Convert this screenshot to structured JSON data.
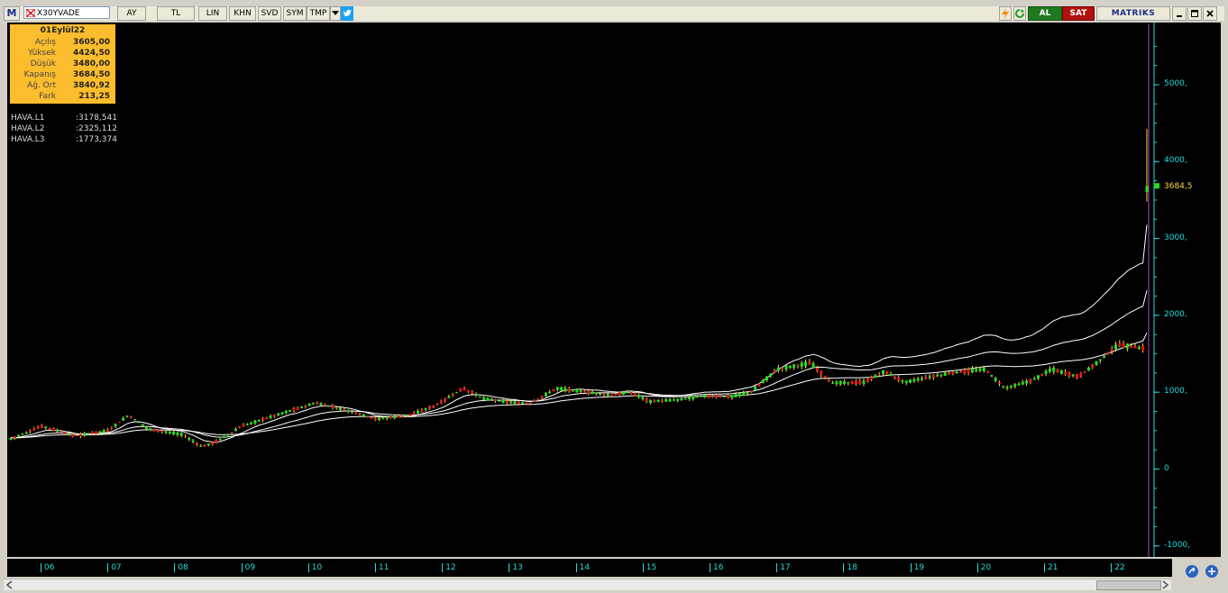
{
  "toolbar": {
    "app_mark": "M",
    "symbol": "X30YVADE",
    "buttons": [
      "AY",
      "TL",
      "LIN",
      "KHN",
      "SVD",
      "SYM",
      "TMP"
    ],
    "buy_label": "AL",
    "sell_label": "SAT",
    "brand": "MATRIKS",
    "colors": {
      "buy": "#1f7a1f",
      "sell": "#b01212",
      "brand": "#1c2e8c"
    }
  },
  "ohlc": {
    "date": "01Eylül22",
    "rows": [
      {
        "label": "Açılış",
        "value": "3605,00"
      },
      {
        "label": "Yüksek",
        "value": "4424,50"
      },
      {
        "label": "Düşük",
        "value": "3480,00"
      },
      {
        "label": "Kapanış",
        "value": "3684,50"
      },
      {
        "label": "Ağ. Ort",
        "value": "3840,92"
      },
      {
        "label": "Fark",
        "value": "213,25"
      }
    ]
  },
  "indicators": [
    {
      "name": "HAVA.L1",
      "value": ":3178,541"
    },
    {
      "name": "HAVA.L2",
      "value": ":2325,112"
    },
    {
      "name": "HAVA.L3",
      "value": ":1773,374"
    }
  ],
  "chart_data": {
    "type": "candlestick",
    "y_ticks": [
      "5000,",
      "4000,",
      "3000,",
      "2000,",
      "1000,",
      "0",
      "-1000,"
    ],
    "y_tick_values": [
      5000,
      4000,
      3000,
      2000,
      1000,
      0,
      -1000
    ],
    "ylim": [
      -1000,
      5000
    ],
    "x_ticks": [
      "06",
      "07",
      "08",
      "09",
      "10",
      "11",
      "12",
      "13",
      "14",
      "15",
      "16",
      "17",
      "18",
      "19",
      "20",
      "21",
      "22"
    ],
    "last_price": "3684,5",
    "last_value": 3684.5,
    "last_candle": {
      "open": 3605,
      "high": 4424.5,
      "low": 3480,
      "close": 3684.5
    },
    "close_path": [
      [
        0,
        380
      ],
      [
        0.3,
        480
      ],
      [
        0.5,
        560
      ],
      [
        1,
        430
      ],
      [
        1.5,
        500
      ],
      [
        1.8,
        700
      ],
      [
        2.1,
        520
      ],
      [
        2.6,
        450
      ],
      [
        2.9,
        290
      ],
      [
        3.1,
        350
      ],
      [
        3.5,
        560
      ],
      [
        4,
        700
      ],
      [
        4.6,
        860
      ],
      [
        5,
        780
      ],
      [
        5.5,
        650
      ],
      [
        6,
        700
      ],
      [
        6.4,
        830
      ],
      [
        6.8,
        1050
      ],
      [
        7.1,
        920
      ],
      [
        7.4,
        880
      ],
      [
        7.8,
        850
      ],
      [
        8.2,
        1050
      ],
      [
        8.6,
        1010
      ],
      [
        9,
        960
      ],
      [
        9.3,
        1000
      ],
      [
        9.6,
        880
      ],
      [
        10,
        900
      ],
      [
        10.4,
        950
      ],
      [
        10.8,
        940
      ],
      [
        11.1,
        1000
      ],
      [
        11.5,
        1300
      ],
      [
        12,
        1380
      ],
      [
        12.3,
        1120
      ],
      [
        12.8,
        1130
      ],
      [
        13.1,
        1270
      ],
      [
        13.4,
        1130
      ],
      [
        13.8,
        1200
      ],
      [
        14.1,
        1250
      ],
      [
        14.6,
        1300
      ],
      [
        14.9,
        1050
      ],
      [
        15.3,
        1150
      ],
      [
        15.6,
        1300
      ],
      [
        16,
        1200
      ],
      [
        16.3,
        1400
      ],
      [
        16.6,
        1620
      ],
      [
        17.1,
        1550
      ],
      [
        17.4,
        1450
      ],
      [
        17.7,
        1600
      ],
      [
        18,
        2000
      ],
      [
        18.2,
        2350
      ],
      [
        18.5,
        2600
      ],
      [
        18.8,
        2900
      ],
      [
        19,
        3000
      ],
      [
        19.1,
        3684.5
      ]
    ],
    "ma": [
      {
        "name": "HAVA.L1",
        "color": "#ffffff",
        "last": 3178.541
      },
      {
        "name": "HAVA.L2",
        "color": "#ffffff",
        "last": 2325.112
      },
      {
        "name": "HAVA.L3",
        "color": "#ffffff",
        "last": 1773.374
      }
    ],
    "colors": {
      "up": "#22dd22",
      "down": "#e01818",
      "wick": "#ffd84a",
      "cursor": "#c040c0",
      "grid_axis": "#22dddd"
    }
  }
}
